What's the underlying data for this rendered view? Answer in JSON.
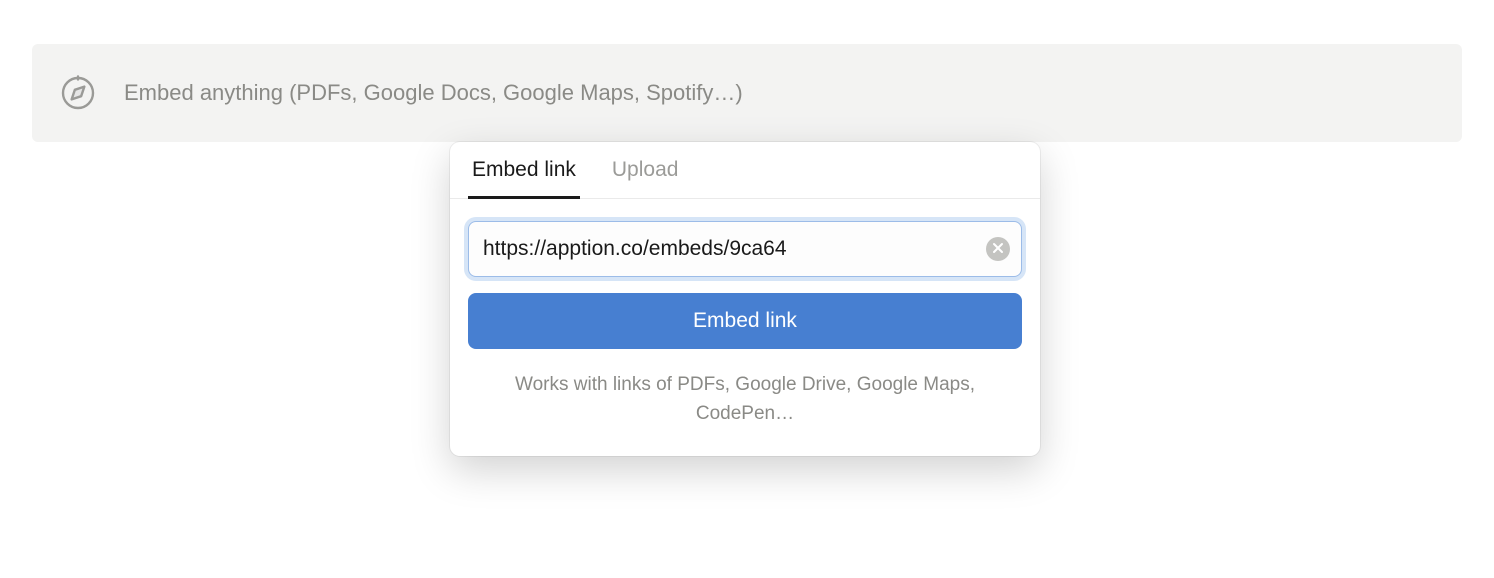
{
  "placeholder": {
    "text": "Embed anything (PDFs, Google Docs, Google Maps, Spotify…)"
  },
  "popover": {
    "tabs": {
      "embed_link": "Embed link",
      "upload": "Upload"
    },
    "url_value": "https://apption.co/embeds/9ca64",
    "submit_label": "Embed link",
    "hint": "Works with links of PDFs, Google Drive, Google Maps, CodePen…"
  }
}
